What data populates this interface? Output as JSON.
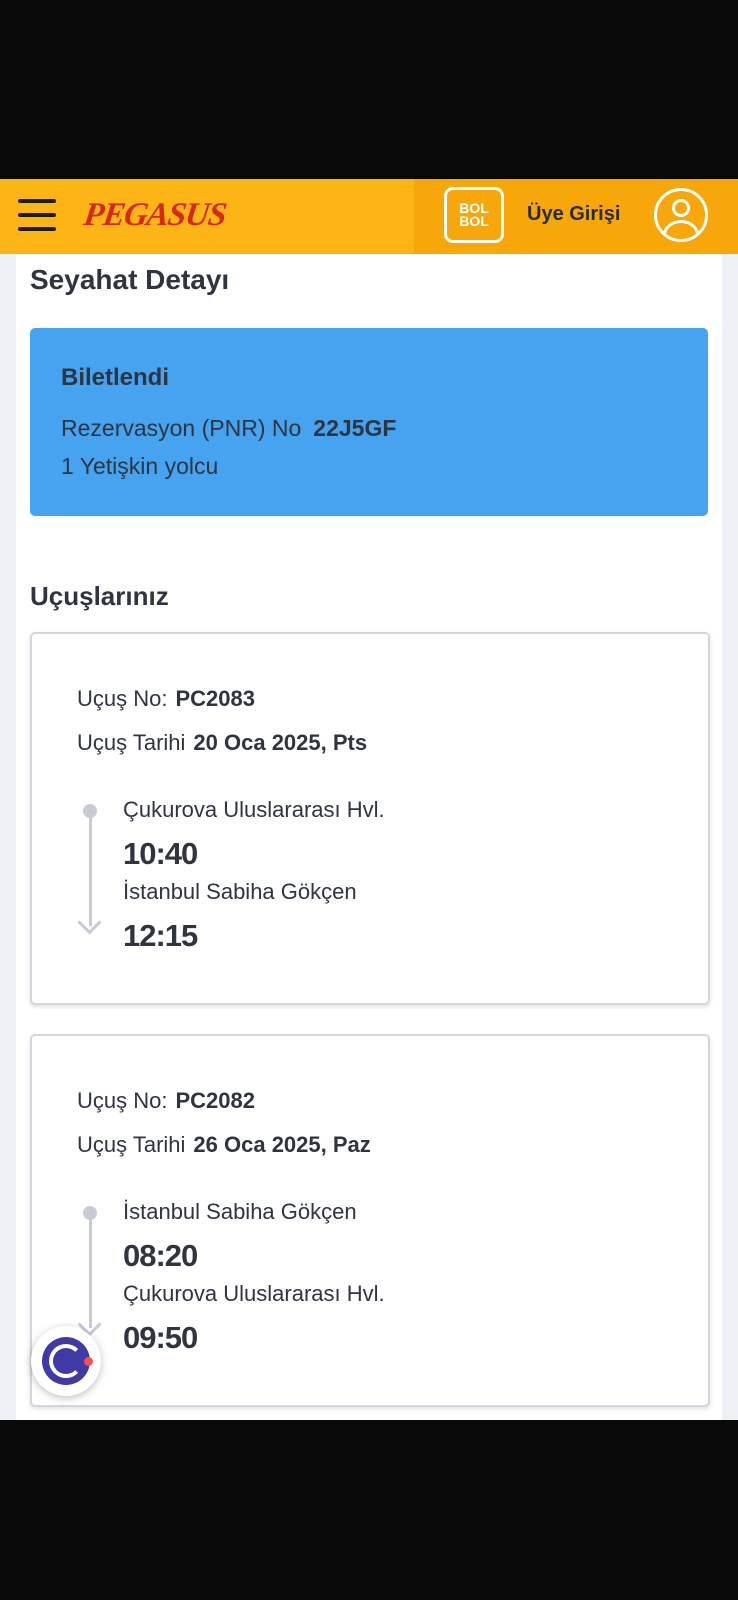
{
  "header": {
    "logo_text": "PEGASUS",
    "bolbol_top": "BOL",
    "bolbol_bottom": "BOL",
    "member_login_label": "Üye Girişi",
    "colors": {
      "primary": "#fdb515",
      "secondary": "#f7a70a",
      "logo": "#d8271c"
    }
  },
  "page": {
    "title": "Seyahat Detayı"
  },
  "status": {
    "title": "Biletlendi",
    "pnr_label": "Rezervasyon (PNR) No",
    "pnr_value": "22J5GF",
    "passengers": "1 Yetişkin yolcu",
    "color": "#45a3f0"
  },
  "flights_section": {
    "title": "Uçuşlarınız"
  },
  "flights": [
    {
      "flight_no_label": "Uçuş No:",
      "flight_no": "PC2083",
      "date_label": "Uçuş Tarihi",
      "date": "20 Oca 2025, Pts",
      "departure_airport": "Çukurova Uluslararası Hvl.",
      "departure_time": "10:40",
      "arrival_airport": "İstanbul Sabiha Gökçen",
      "arrival_time": "12:15"
    },
    {
      "flight_no_label": "Uçuş No:",
      "flight_no": "PC2082",
      "date_label": "Uçuş Tarihi",
      "date": "26 Oca 2025, Paz",
      "departure_airport": "İstanbul Sabiha Gökçen",
      "departure_time": "08:20",
      "arrival_airport": "Çukurova Uluslararası Hvl.",
      "arrival_time": "09:50"
    }
  ],
  "icons": {
    "menu": "hamburger-menu-icon",
    "bolbol": "bolbol-logo-icon",
    "user": "user-avatar-icon",
    "assistant": "chat-assistant-icon"
  }
}
